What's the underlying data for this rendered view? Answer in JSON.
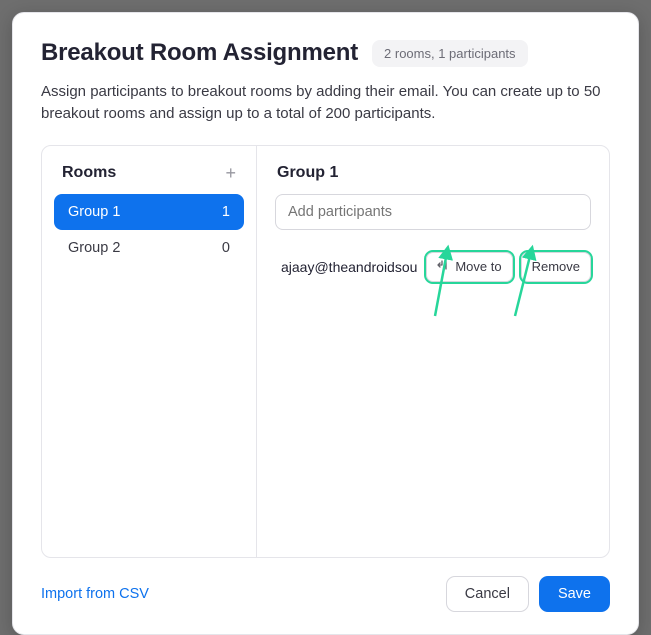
{
  "header": {
    "title": "Breakout Room Assignment",
    "badge": "2 rooms, 1 participants"
  },
  "description": "Assign participants to breakout rooms by adding their email. You can create up to 50 breakout rooms and assign up to a total of 200 participants.",
  "rooms_panel": {
    "heading": "Rooms",
    "items": [
      {
        "name": "Group 1",
        "count": "1",
        "selected": true
      },
      {
        "name": "Group 2",
        "count": "0",
        "selected": false
      }
    ]
  },
  "detail_panel": {
    "heading": "Group 1",
    "add_placeholder": "Add participants",
    "participant_email": "ajaay@theandroidsou",
    "move_to_label": "Move to",
    "remove_label": "Remove"
  },
  "footer": {
    "import_label": "Import from CSV",
    "cancel_label": "Cancel",
    "save_label": "Save"
  },
  "colors": {
    "accent": "#0e72ed",
    "highlight": "#27d69a"
  }
}
